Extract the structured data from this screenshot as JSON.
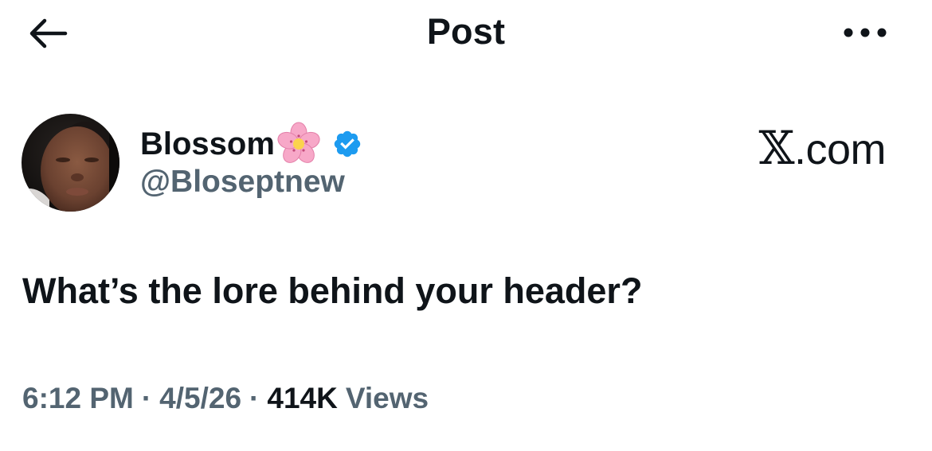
{
  "header": {
    "title": "Post",
    "back_icon": "arrow-left-icon",
    "more_icon": "more-horizontal-icon"
  },
  "author": {
    "display_name": "Blossom",
    "name_emoji": "cherry-blossom-icon",
    "verified_icon": "verified-badge-icon",
    "verified_color": "#1d9bf0",
    "handle": "@Bloseptnew"
  },
  "watermark": {
    "x_letter": "𝕏",
    "domain": ".com"
  },
  "post": {
    "text": "What’s the lore behind your header?"
  },
  "meta": {
    "time": "6:12 PM",
    "separator": "·",
    "date": "4/5/26",
    "views_count": "414K",
    "views_label": "Views"
  },
  "colors": {
    "text_primary": "#0f1419",
    "text_secondary": "#536471",
    "background": "#ffffff"
  }
}
